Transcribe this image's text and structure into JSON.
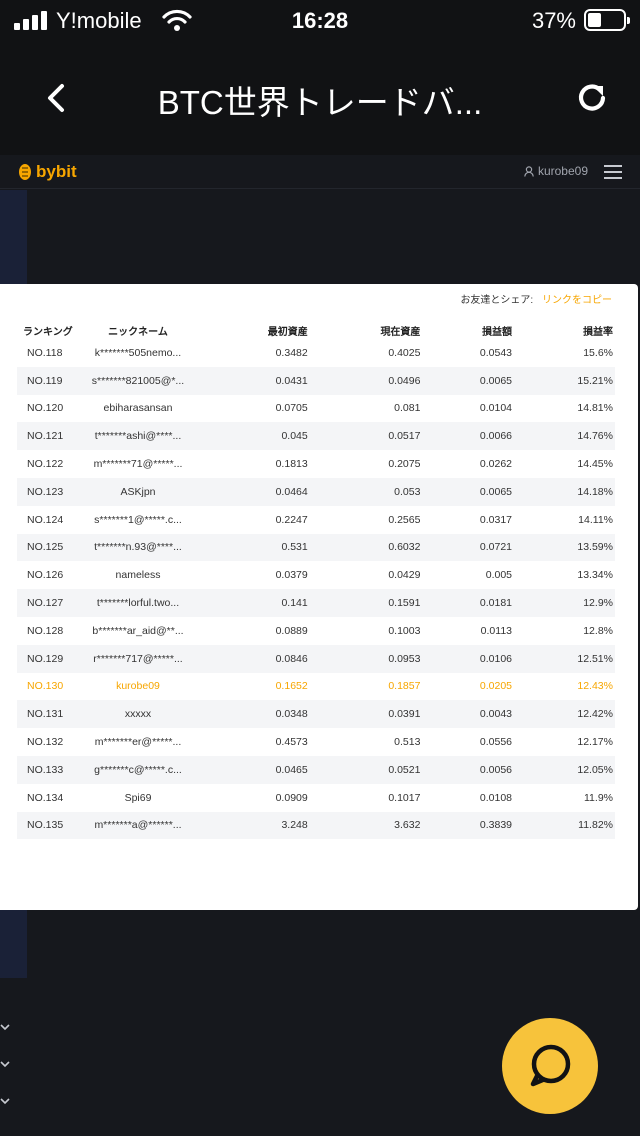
{
  "status_bar": {
    "carrier": "Y!mobile",
    "time": "16:28",
    "battery_percent": "37%"
  },
  "nav": {
    "title": "BTC世界トレードバ..."
  },
  "site": {
    "logo": "bybit",
    "username": "kurobe09"
  },
  "share": {
    "label": "お友達とシェア:",
    "copy_link": "リンクをコピー"
  },
  "table": {
    "headers": [
      "ランキング",
      "ニックネーム",
      "最初資産",
      "現在資産",
      "損益額",
      "損益率"
    ],
    "rows": [
      [
        "NO.118",
        "k*******505nemo...",
        "0.3482",
        "0.4025",
        "0.0543",
        "15.6%"
      ],
      [
        "NO.119",
        "s*******821005@*...",
        "0.0431",
        "0.0496",
        "0.0065",
        "15.21%"
      ],
      [
        "NO.120",
        "ebiharasansan",
        "0.0705",
        "0.081",
        "0.0104",
        "14.81%"
      ],
      [
        "NO.121",
        "t*******ashi@****...",
        "0.045",
        "0.0517",
        "0.0066",
        "14.76%"
      ],
      [
        "NO.122",
        "m*******71@*****...",
        "0.1813",
        "0.2075",
        "0.0262",
        "14.45%"
      ],
      [
        "NO.123",
        "ASKjpn",
        "0.0464",
        "0.053",
        "0.0065",
        "14.18%"
      ],
      [
        "NO.124",
        "s*******1@*****.c...",
        "0.2247",
        "0.2565",
        "0.0317",
        "14.11%"
      ],
      [
        "NO.125",
        "t*******n.93@****...",
        "0.531",
        "0.6032",
        "0.0721",
        "13.59%"
      ],
      [
        "NO.126",
        "nameless",
        "0.0379",
        "0.0429",
        "0.005",
        "13.34%"
      ],
      [
        "NO.127",
        "t*******lorful.two...",
        "0.141",
        "0.1591",
        "0.0181",
        "12.9%"
      ],
      [
        "NO.128",
        "b*******ar_aid@**...",
        "0.0889",
        "0.1003",
        "0.0113",
        "12.8%"
      ],
      [
        "NO.129",
        "r*******717@*****...",
        "0.0846",
        "0.0953",
        "0.0106",
        "12.51%"
      ],
      [
        "NO.130",
        "kurobe09",
        "0.1652",
        "0.1857",
        "0.0205",
        "12.43%"
      ],
      [
        "NO.131",
        "xxxxx",
        "0.0348",
        "0.0391",
        "0.0043",
        "12.42%"
      ],
      [
        "NO.132",
        "m*******er@*****...",
        "0.4573",
        "0.513",
        "0.0556",
        "12.17%"
      ],
      [
        "NO.133",
        "g*******c@*****.c...",
        "0.0465",
        "0.0521",
        "0.0056",
        "12.05%"
      ],
      [
        "NO.134",
        "Spi69",
        "0.0909",
        "0.1017",
        "0.0108",
        "11.9%"
      ],
      [
        "NO.135",
        "m*******a@******...",
        "3.248",
        "3.632",
        "0.3839",
        "11.82%"
      ]
    ],
    "highlight_row": 12
  },
  "colors": {
    "accent": "#f7a600",
    "fab": "#f7c33b",
    "page_bg": "#111214"
  }
}
